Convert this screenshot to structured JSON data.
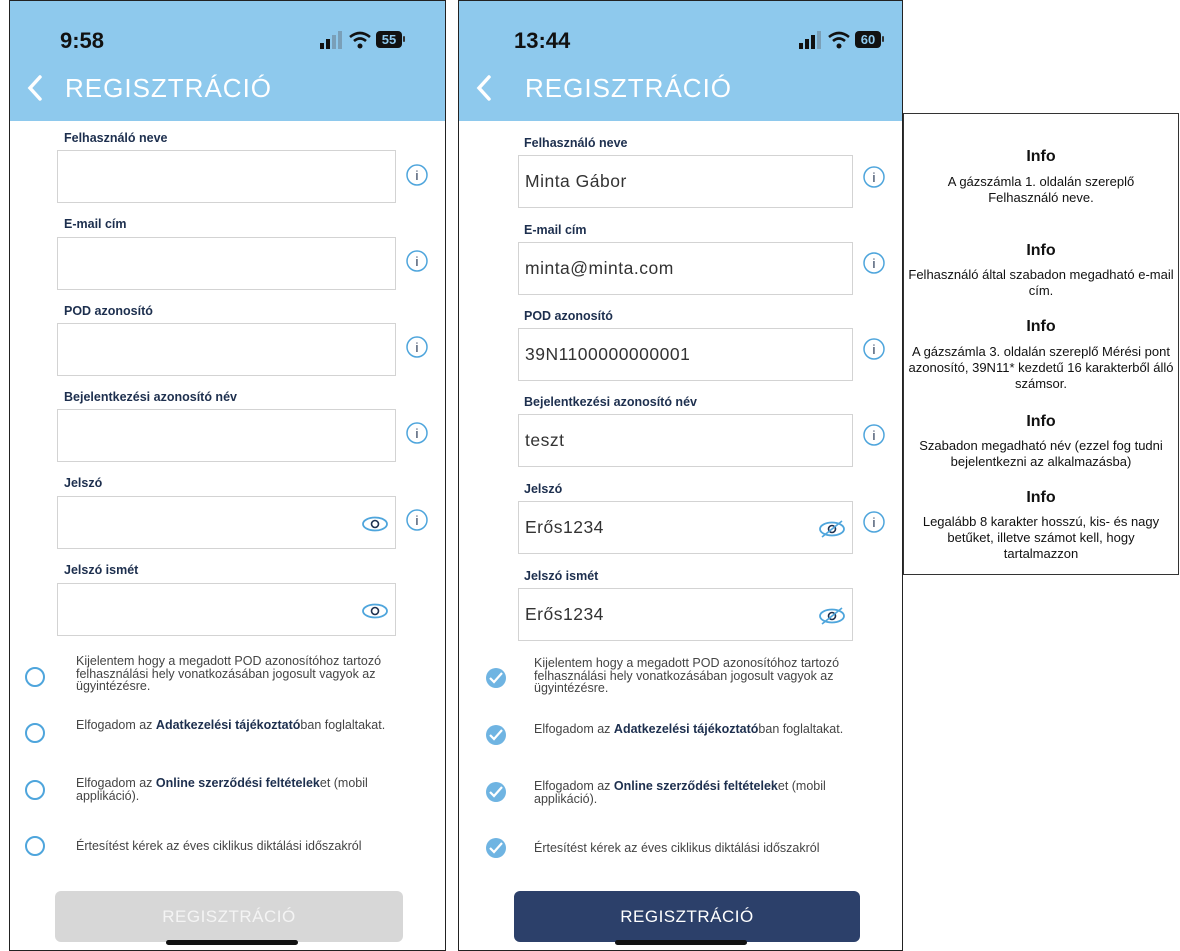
{
  "left": {
    "time": "9:58",
    "battery": "55",
    "title": "REGISZTRÁCIÓ",
    "fields": [
      {
        "label": "Felhasználó neve",
        "value": ""
      },
      {
        "label": "E-mail cím",
        "value": ""
      },
      {
        "label": "POD azonosító",
        "value": ""
      },
      {
        "label": "Bejelentkezési azonosító név",
        "value": ""
      },
      {
        "label": "Jelszó",
        "value": ""
      },
      {
        "label": "Jelszó ismét",
        "value": ""
      }
    ],
    "checkboxes": [
      {
        "text": "Kijelentem hogy a megadott POD azonosítóhoz tartozó felhasználási hely vonatkozásában jogosult vagyok az ügyintézésre.",
        "checked": false
      },
      {
        "pre": "Elfogadom az ",
        "bold": "Adatkezelési tájékoztató",
        "post": "ban foglaltakat.",
        "checked": false
      },
      {
        "pre": "Elfogadom az ",
        "bold": "Online szerződési feltételek",
        "post": "et (mobil applikáció).",
        "checked": false
      },
      {
        "text": "Értesítést kérek az éves ciklikus diktálási időszakról",
        "checked": false
      }
    ],
    "button": "REGISZTRÁCIÓ"
  },
  "right": {
    "time": "13:44",
    "battery": "60",
    "title": "REGISZTRÁCIÓ",
    "fields": [
      {
        "label": "Felhasználó neve",
        "value": "Minta Gábor"
      },
      {
        "label": "E-mail cím",
        "value": "minta@minta.com"
      },
      {
        "label": "POD azonosító",
        "value": "39N1100000000001"
      },
      {
        "label": "Bejelentkezési azonosító név",
        "value": "teszt"
      },
      {
        "label": "Jelszó",
        "value": "Erős1234"
      },
      {
        "label": "Jelszó ismét",
        "value": "Erős1234"
      }
    ],
    "checkboxes": [
      {
        "text": "Kijelentem hogy a megadott POD azonosítóhoz tartozó felhasználási hely vonatkozásában jogosult vagyok az ügyintézésre.",
        "checked": true
      },
      {
        "pre": "Elfogadom az ",
        "bold": "Adatkezelési tájékoztató",
        "post": "ban foglaltakat.",
        "checked": true
      },
      {
        "pre": "Elfogadom az ",
        "bold": "Online szerződési feltételek",
        "post": "et (mobil applikáció).",
        "checked": true
      },
      {
        "text": "Értesítést kérek az éves ciklikus diktálási időszakról",
        "checked": true
      }
    ],
    "button": "REGISZTRÁCIÓ"
  },
  "info_panel": [
    {
      "title": "Info",
      "text": "A gázszámla 1. oldalán szereplő Felhasználó neve."
    },
    {
      "title": "Info",
      "text": "Felhasználó által szabadon megadható e-mail cím."
    },
    {
      "title": "Info",
      "text": "A gázszámla 3. oldalán szereplő Mérési pont azonosító, 39N11* kezdetű 16 karakterből álló számsor."
    },
    {
      "title": "Info",
      "text": "Szabadon megadható név (ezzel fog tudni bejelentkezni az alkalmazásba)"
    },
    {
      "title": "Info",
      "text": "Legalább 8 karakter hosszú, kis- és nagy betűket, illetve számot kell, hogy tartalmazzon"
    }
  ],
  "colors": {
    "header_bg": "#8ec9ed",
    "button_active": "#2c406a",
    "button_disabled": "#d7d7d7",
    "check_accent": "#4ea5dc"
  },
  "icons": [
    "back-chevron-icon",
    "info-icon",
    "eye-icon",
    "eye-slash-icon",
    "check-icon",
    "signal-icon",
    "wifi-icon",
    "battery-icon"
  ]
}
